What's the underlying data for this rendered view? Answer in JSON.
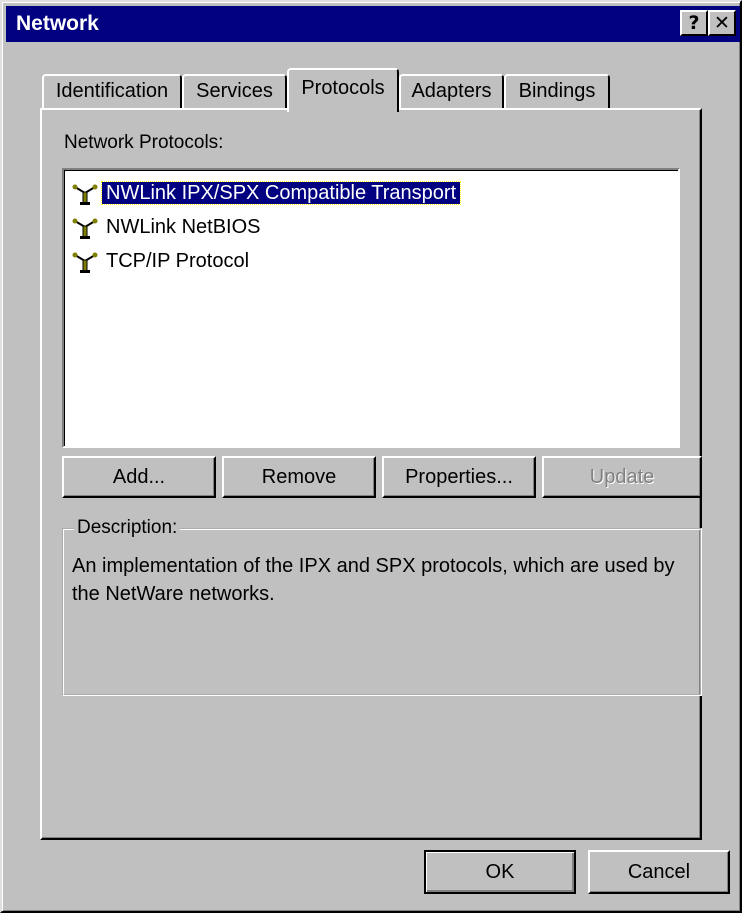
{
  "window": {
    "title": "Network",
    "help_glyph": "?",
    "close_glyph": "✕"
  },
  "tabs": [
    {
      "label": "Identification",
      "active": false
    },
    {
      "label": "Services",
      "active": false
    },
    {
      "label": "Protocols",
      "active": true
    },
    {
      "label": "Adapters",
      "active": false
    },
    {
      "label": "Bindings",
      "active": false
    }
  ],
  "protocols": {
    "label": "Network Protocols:",
    "items": [
      {
        "label": "NWLink IPX/SPX Compatible Transport",
        "selected": true,
        "icon": "network-protocol-icon"
      },
      {
        "label": "NWLink NetBIOS",
        "selected": false,
        "icon": "network-protocol-icon"
      },
      {
        "label": "TCP/IP Protocol",
        "selected": false,
        "icon": "network-protocol-icon"
      }
    ]
  },
  "actions": {
    "add": "Add...",
    "remove": "Remove",
    "properties": "Properties...",
    "update": "Update"
  },
  "description": {
    "legend": "Description:",
    "text": "An implementation of the IPX and SPX protocols, which are used by the NetWare networks."
  },
  "footer": {
    "ok": "OK",
    "cancel": "Cancel"
  },
  "colors": {
    "face": "#c0c0c0",
    "titlebar": "#000080",
    "selection": "#000080"
  }
}
